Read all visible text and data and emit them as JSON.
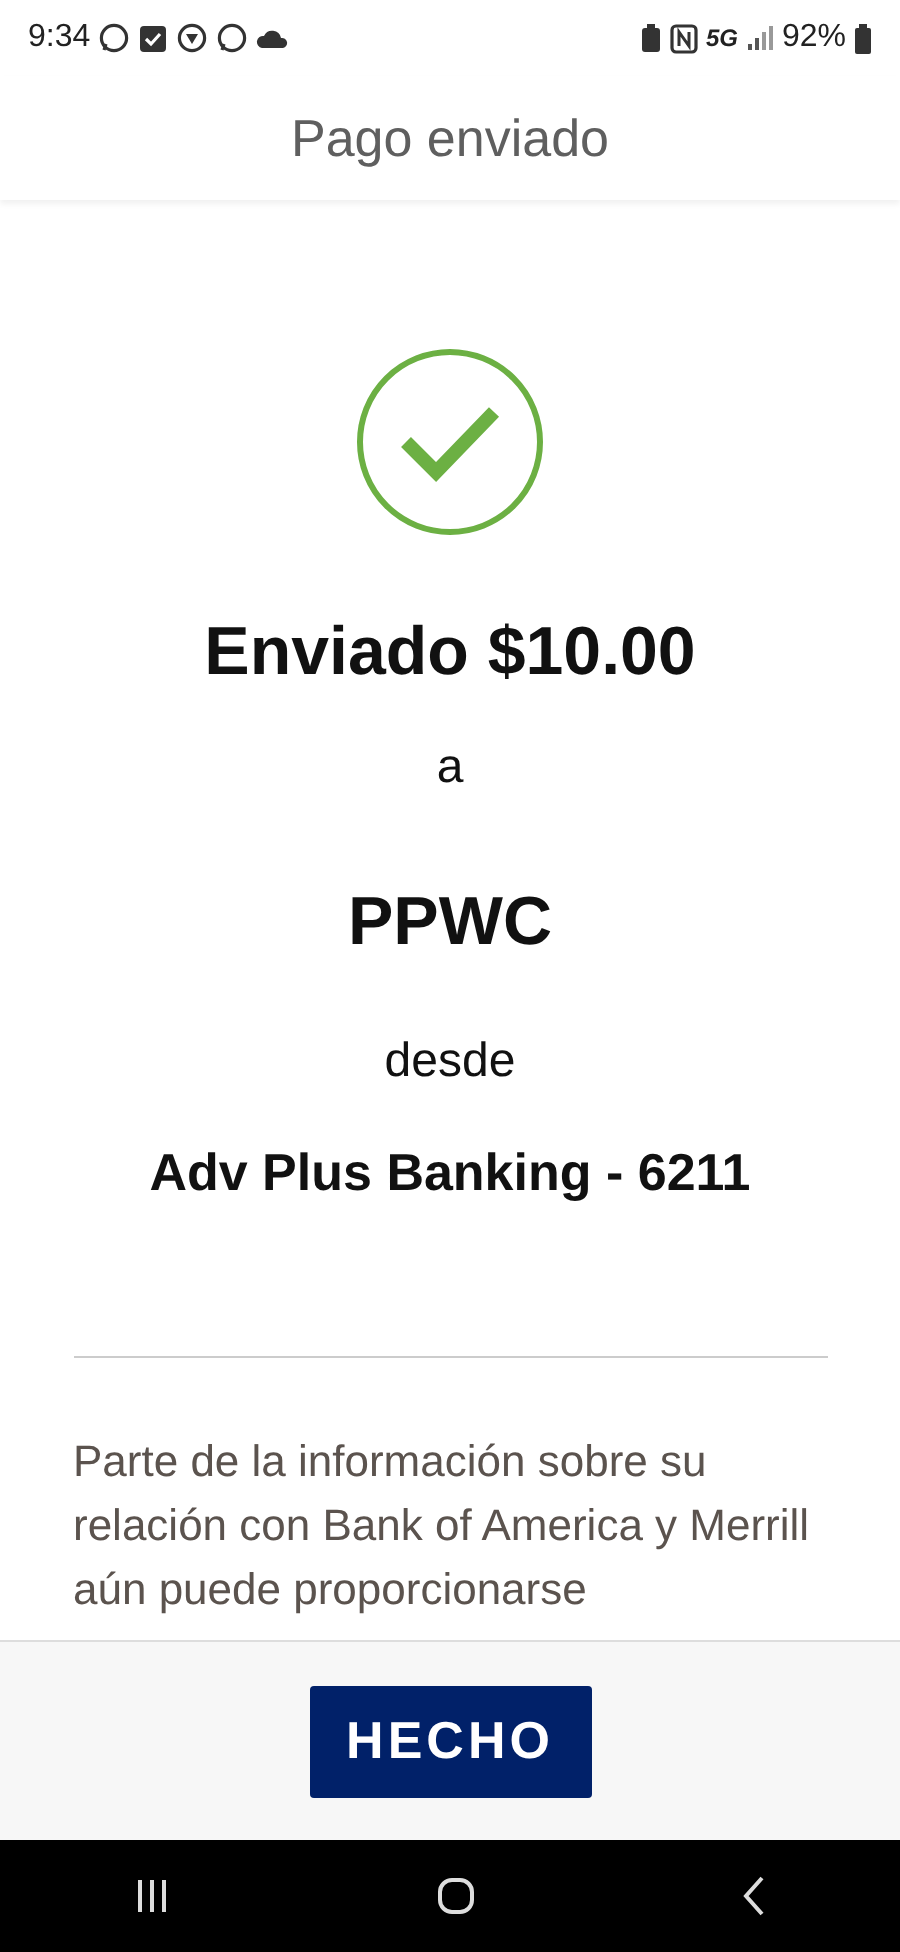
{
  "status_bar": {
    "time": "9:34",
    "network": "5G",
    "battery": "92%"
  },
  "header": {
    "title": "Pago enviado"
  },
  "confirmation": {
    "amount_line": "Enviado $10.00",
    "to_word": "a",
    "recipient": "PPWC",
    "from_word": "desde",
    "account": "Adv Plus Banking - 6211"
  },
  "disclaimer": "Parte de la información sobre su relación con Bank of America y Merrill aún puede proporcionarse",
  "footer": {
    "button": "HECHO"
  }
}
